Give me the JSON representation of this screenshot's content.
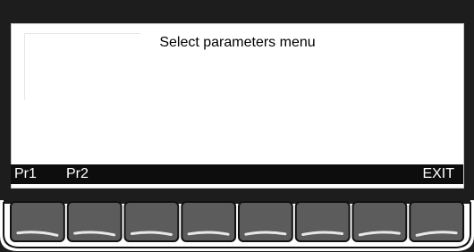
{
  "screen": {
    "title": "Select parameters menu"
  },
  "softkeys": {
    "f1_label": "Pr1",
    "f2_label": "Pr2",
    "f8_label": "EXIT"
  },
  "buttons": [
    {
      "name": "softkey-1-button"
    },
    {
      "name": "softkey-2-button"
    },
    {
      "name": "softkey-3-button"
    },
    {
      "name": "softkey-4-button"
    },
    {
      "name": "softkey-5-button"
    },
    {
      "name": "softkey-6-button"
    },
    {
      "name": "softkey-7-button"
    },
    {
      "name": "softkey-8-button"
    }
  ],
  "colors": {
    "bezel": "#1d1d1d",
    "button_face": "#5c5c5c",
    "button_edge": "#111111",
    "screen_bg": "#ffffff",
    "softkey_bar": "#0d0d0d"
  }
}
